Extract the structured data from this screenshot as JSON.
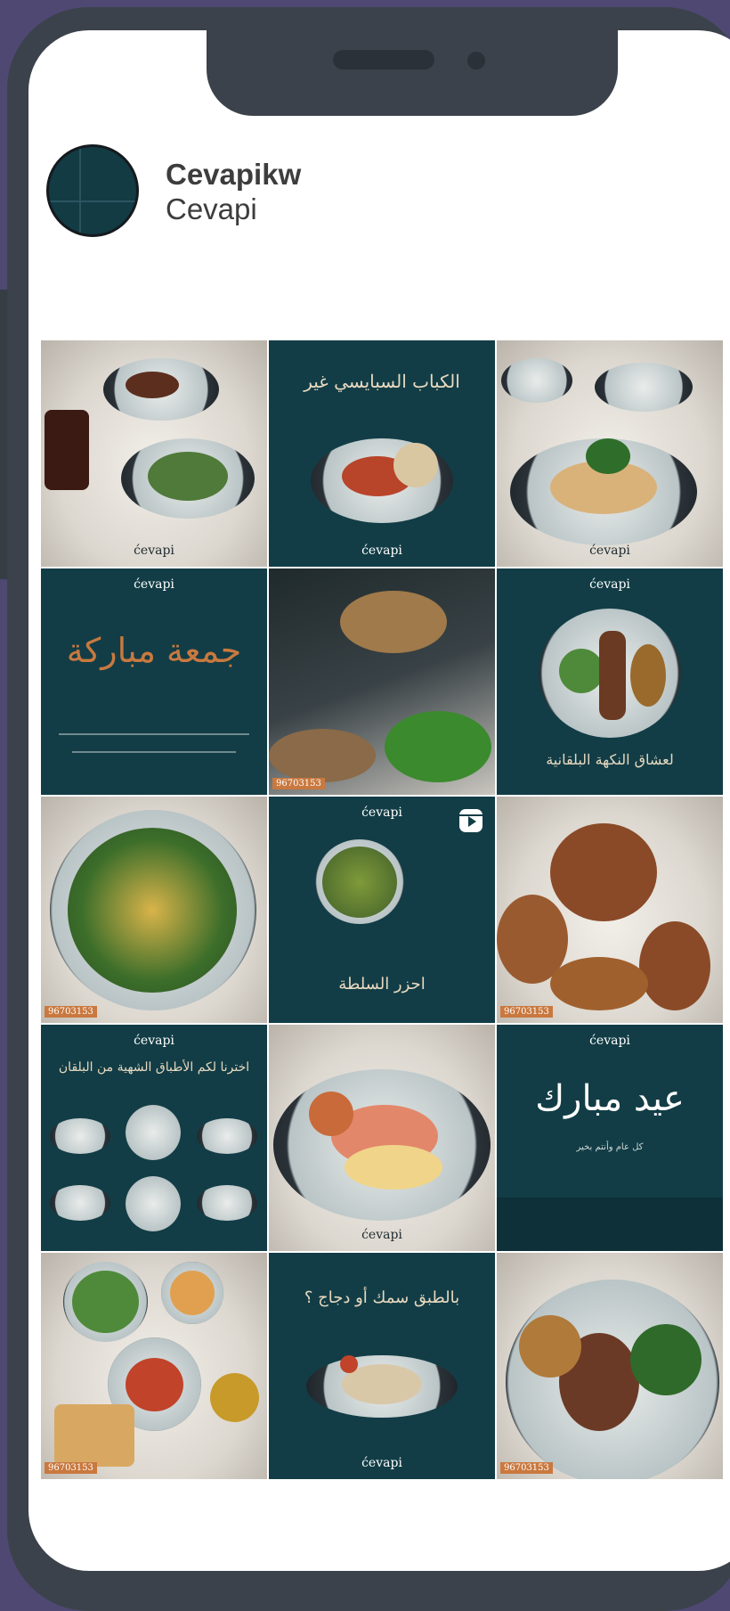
{
  "profile": {
    "username": "Cevapikw",
    "full_name": "Cevapi"
  },
  "brand_mark": "ćevapi",
  "phone_badge": "96703153",
  "posts": [
    {
      "type": "photo"
    },
    {
      "type": "graphic",
      "caption": "الكباب السبايسي غير"
    },
    {
      "type": "photo"
    },
    {
      "type": "graphic",
      "caption": "جمعة مباركة"
    },
    {
      "type": "photo"
    },
    {
      "type": "graphic",
      "caption": "لعشاق النكهة البلقانية"
    },
    {
      "type": "photo"
    },
    {
      "type": "reel",
      "caption": "احزر السلطة"
    },
    {
      "type": "photo"
    },
    {
      "type": "graphic",
      "caption": "اخترنا لكم الأطباق الشهية من البلقان"
    },
    {
      "type": "photo"
    },
    {
      "type": "graphic",
      "caption": "عيد مبارك",
      "subcaption": "كل عام وأنتم بخير"
    },
    {
      "type": "photo"
    },
    {
      "type": "graphic",
      "caption": "بالطبق سمك أو دجاج ؟"
    },
    {
      "type": "photo"
    }
  ],
  "colors": {
    "background": "#4e4872",
    "phone_frame": "#3b424b",
    "brand_teal": "#123d46",
    "caption_gold": "#e8d9c0"
  }
}
